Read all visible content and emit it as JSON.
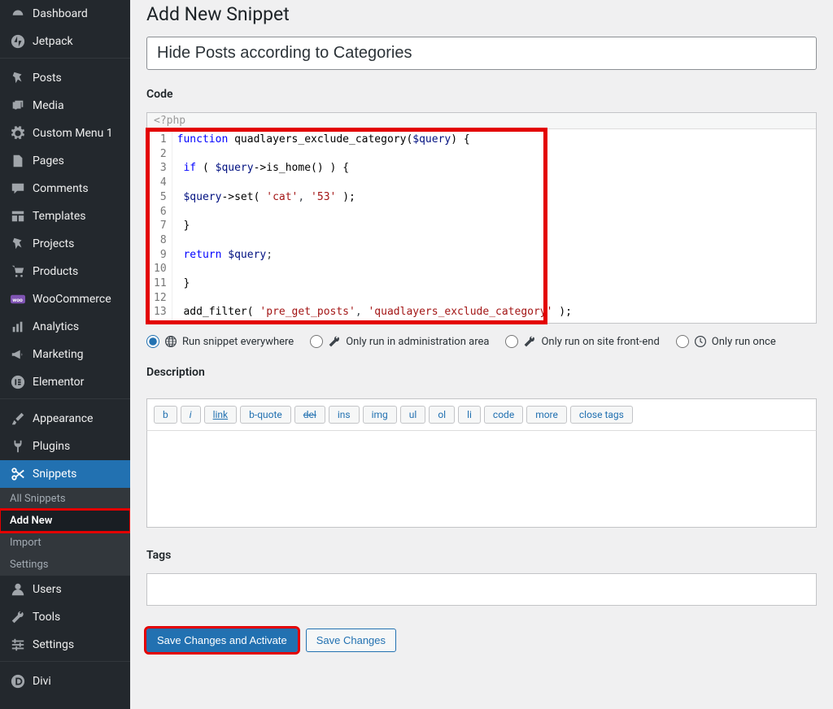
{
  "page": {
    "title": "Add New Snippet",
    "snippet_title_value": "Hide Posts according to Categories"
  },
  "sidebar": {
    "items": [
      {
        "icon": "dashboard",
        "label": "Dashboard"
      },
      {
        "icon": "jetpack",
        "label": "Jetpack"
      },
      {
        "sep": true
      },
      {
        "icon": "pin",
        "label": "Posts"
      },
      {
        "icon": "media",
        "label": "Media"
      },
      {
        "icon": "gear",
        "label": "Custom Menu 1"
      },
      {
        "icon": "page",
        "label": "Pages"
      },
      {
        "icon": "comment",
        "label": "Comments"
      },
      {
        "icon": "template",
        "label": "Templates"
      },
      {
        "icon": "pin",
        "label": "Projects"
      },
      {
        "icon": "product",
        "label": "Products"
      },
      {
        "icon": "woo",
        "label": "WooCommerce"
      },
      {
        "icon": "chart",
        "label": "Analytics"
      },
      {
        "icon": "megaphone",
        "label": "Marketing"
      },
      {
        "icon": "elementor",
        "label": "Elementor"
      },
      {
        "sep": true
      },
      {
        "icon": "brush",
        "label": "Appearance"
      },
      {
        "icon": "plug",
        "label": "Plugins"
      },
      {
        "icon": "scissors",
        "label": "Snippets",
        "active": true,
        "submenu": [
          {
            "label": "All Snippets"
          },
          {
            "label": "Add New",
            "current": true,
            "highlight": true
          },
          {
            "label": "Import"
          },
          {
            "label": "Settings"
          }
        ]
      },
      {
        "icon": "user",
        "label": "Users"
      },
      {
        "icon": "wrench",
        "label": "Tools"
      },
      {
        "icon": "sliders",
        "label": "Settings"
      },
      {
        "sep": true
      },
      {
        "icon": "divi",
        "label": "Divi"
      }
    ]
  },
  "code": {
    "section_label": "Code",
    "php_open": "<?php",
    "line_count": 13,
    "lines": [
      {
        "n": 1,
        "html": "<span class='kw'>function</span> <span class='fn'>quadlayers_exclude_category</span><span class='paren'>(</span><span class='var'>$query</span><span class='paren'>)</span> <span class='paren'>{</span>"
      },
      {
        "n": 2,
        "html": ""
      },
      {
        "n": 3,
        "html": " <span class='kw'>if</span> <span class='paren'>(</span> <span class='var'>$query</span><span class='arrow'>-&gt;</span><span class='fn'>is_home</span><span class='paren'>() )</span> <span class='paren'>{</span>"
      },
      {
        "n": 4,
        "html": ""
      },
      {
        "n": 5,
        "html": " <span class='var'>$query</span><span class='arrow'>-&gt;</span><span class='fn'>set</span><span class='paren'>(</span> <span class='str'>'cat'</span>, <span class='str'>'53'</span> <span class='paren'>);</span>"
      },
      {
        "n": 6,
        "html": ""
      },
      {
        "n": 7,
        "html": " <span class='paren'>}</span>"
      },
      {
        "n": 8,
        "html": ""
      },
      {
        "n": 9,
        "html": " <span class='kw'>return</span> <span class='var'>$query</span>;"
      },
      {
        "n": 10,
        "html": ""
      },
      {
        "n": 11,
        "html": " <span class='paren'>}</span>"
      },
      {
        "n": 12,
        "html": ""
      },
      {
        "n": 13,
        "html": " <span class='fn'>add_filter</span><span class='paren'>(</span> <span class='str'>'pre_get_posts'</span>, <span class='str'>'quadlayers_exclude_category'</span> <span class='paren'>);</span>"
      }
    ]
  },
  "scope": {
    "options": [
      {
        "id": "everywhere",
        "icon": "globe",
        "label": "Run snippet everywhere",
        "checked": true
      },
      {
        "id": "admin",
        "icon": "wrench-sm",
        "label": "Only run in administration area",
        "checked": false
      },
      {
        "id": "front",
        "icon": "wrench-sm",
        "label": "Only run on site front-end",
        "checked": false
      },
      {
        "id": "once",
        "icon": "clock",
        "label": "Only run once",
        "checked": false
      }
    ]
  },
  "description": {
    "section_label": "Description",
    "toolbar": [
      "b",
      "i",
      "link",
      "b-quote",
      "del",
      "ins",
      "img",
      "ul",
      "ol",
      "li",
      "code",
      "more",
      "close tags"
    ],
    "value": ""
  },
  "tags": {
    "section_label": "Tags",
    "value": ""
  },
  "buttons": {
    "primary": "Save Changes and Activate",
    "secondary": "Save Changes"
  }
}
